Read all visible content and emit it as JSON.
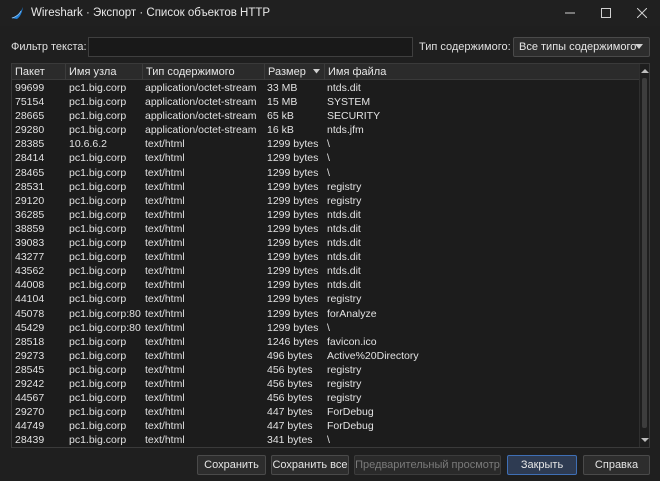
{
  "window": {
    "title": "Wireshark · Экспорт · Список объектов HTTP",
    "controls": [
      "minimize-icon",
      "maximize-icon",
      "close-icon"
    ]
  },
  "filter": {
    "label": "Фильтр текста:",
    "value": "",
    "content_type_label": "Тип содержимого:",
    "content_type_value": "Все типы содержимого"
  },
  "table": {
    "columns": [
      "Пакет",
      "Имя узла",
      "Тип содержимого",
      "Размер",
      "Имя файла"
    ],
    "rows": [
      [
        "99699",
        "pc1.big.corp",
        "application/octet-stream",
        "33 MB",
        "ntds.dit"
      ],
      [
        "75154",
        "pc1.big.corp",
        "application/octet-stream",
        "15 MB",
        "SYSTEM"
      ],
      [
        "28665",
        "pc1.big.corp",
        "application/octet-stream",
        "65 kB",
        "SECURITY"
      ],
      [
        "29280",
        "pc1.big.corp",
        "application/octet-stream",
        "16 kB",
        "ntds.jfm"
      ],
      [
        "28385",
        "10.6.6.2",
        "text/html",
        "1299 bytes",
        "\\"
      ],
      [
        "28414",
        "pc1.big.corp",
        "text/html",
        "1299 bytes",
        "\\"
      ],
      [
        "28465",
        "pc1.big.corp",
        "text/html",
        "1299 bytes",
        "\\"
      ],
      [
        "28531",
        "pc1.big.corp",
        "text/html",
        "1299 bytes",
        "registry"
      ],
      [
        "29120",
        "pc1.big.corp",
        "text/html",
        "1299 bytes",
        "registry"
      ],
      [
        "36285",
        "pc1.big.corp",
        "text/html",
        "1299 bytes",
        "ntds.dit"
      ],
      [
        "38859",
        "pc1.big.corp",
        "text/html",
        "1299 bytes",
        "ntds.dit"
      ],
      [
        "39083",
        "pc1.big.corp",
        "text/html",
        "1299 bytes",
        "ntds.dit"
      ],
      [
        "43277",
        "pc1.big.corp",
        "text/html",
        "1299 bytes",
        "ntds.dit"
      ],
      [
        "43562",
        "pc1.big.corp",
        "text/html",
        "1299 bytes",
        "ntds.dit"
      ],
      [
        "44008",
        "pc1.big.corp",
        "text/html",
        "1299 bytes",
        "ntds.dit"
      ],
      [
        "44104",
        "pc1.big.corp",
        "text/html",
        "1299 bytes",
        "registry"
      ],
      [
        "45078",
        "pc1.big.corp:80",
        "text/html",
        "1299 bytes",
        "forAnalyze"
      ],
      [
        "45429",
        "pc1.big.corp:80",
        "text/html",
        "1299 bytes",
        "\\"
      ],
      [
        "28518",
        "pc1.big.corp",
        "text/html",
        "1246 bytes",
        "favicon.ico"
      ],
      [
        "29273",
        "pc1.big.corp",
        "text/html",
        "496 bytes",
        "Active%20Directory"
      ],
      [
        "28545",
        "pc1.big.corp",
        "text/html",
        "456 bytes",
        "registry"
      ],
      [
        "29242",
        "pc1.big.corp",
        "text/html",
        "456 bytes",
        "registry"
      ],
      [
        "44567",
        "pc1.big.corp",
        "text/html",
        "456 bytes",
        "registry"
      ],
      [
        "29270",
        "pc1.big.corp",
        "text/html",
        "447 bytes",
        "ForDebug"
      ],
      [
        "44749",
        "pc1.big.corp",
        "text/html",
        "447 bytes",
        "ForDebug"
      ],
      [
        "28439",
        "pc1.big.corp",
        "text/html",
        "341 bytes",
        "\\"
      ]
    ]
  },
  "buttons": {
    "save": "Сохранить",
    "save_all": "Сохранить все",
    "preview": "Предварительный просмотр",
    "close": "Закрыть",
    "help": "Справка"
  },
  "colors": {
    "background": "#1f1f1f",
    "icon_blue": "#1f7ed6"
  }
}
